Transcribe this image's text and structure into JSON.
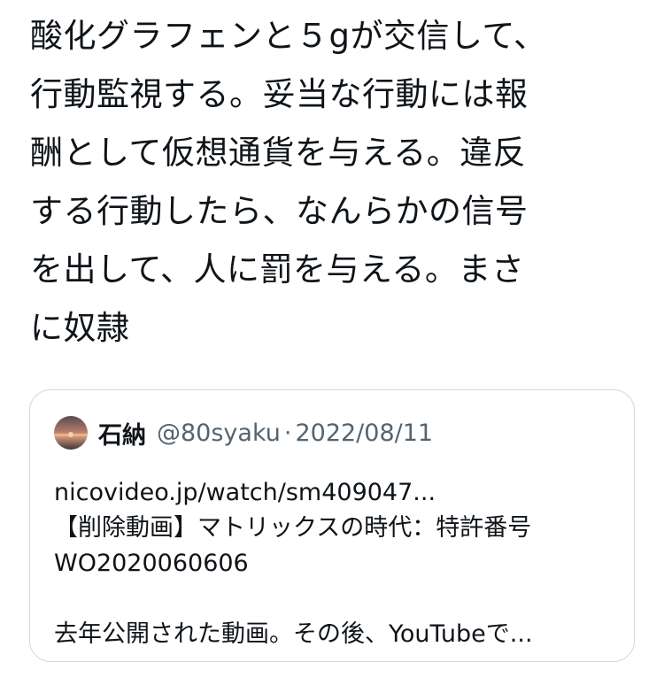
{
  "tweet": {
    "lines": [
      "酸化グラフェンと５gが交信して、",
      "行動監視する。妥当な行動には報",
      "酬として仮想通貨を与える。違反",
      "する行動したら、なんらかの信号",
      "を出して、人に罰を与える。まさ",
      "に奴隷"
    ]
  },
  "quote": {
    "author_name": "石納",
    "handle": "@80syaku",
    "separator": "·",
    "date": "2022/08/11",
    "avatar_icon": "sunset-avatar-icon",
    "lines": [
      "nicovideo.jp/watch/sm409047...",
      "【削除動画】マトリックスの時代：特許番号",
      "WO2020060606",
      "",
      "去年公開された動画。その後、YouTubeで..."
    ]
  },
  "colors": {
    "text": "#0f1419",
    "secondary": "#536471",
    "border": "#cfd9de"
  }
}
